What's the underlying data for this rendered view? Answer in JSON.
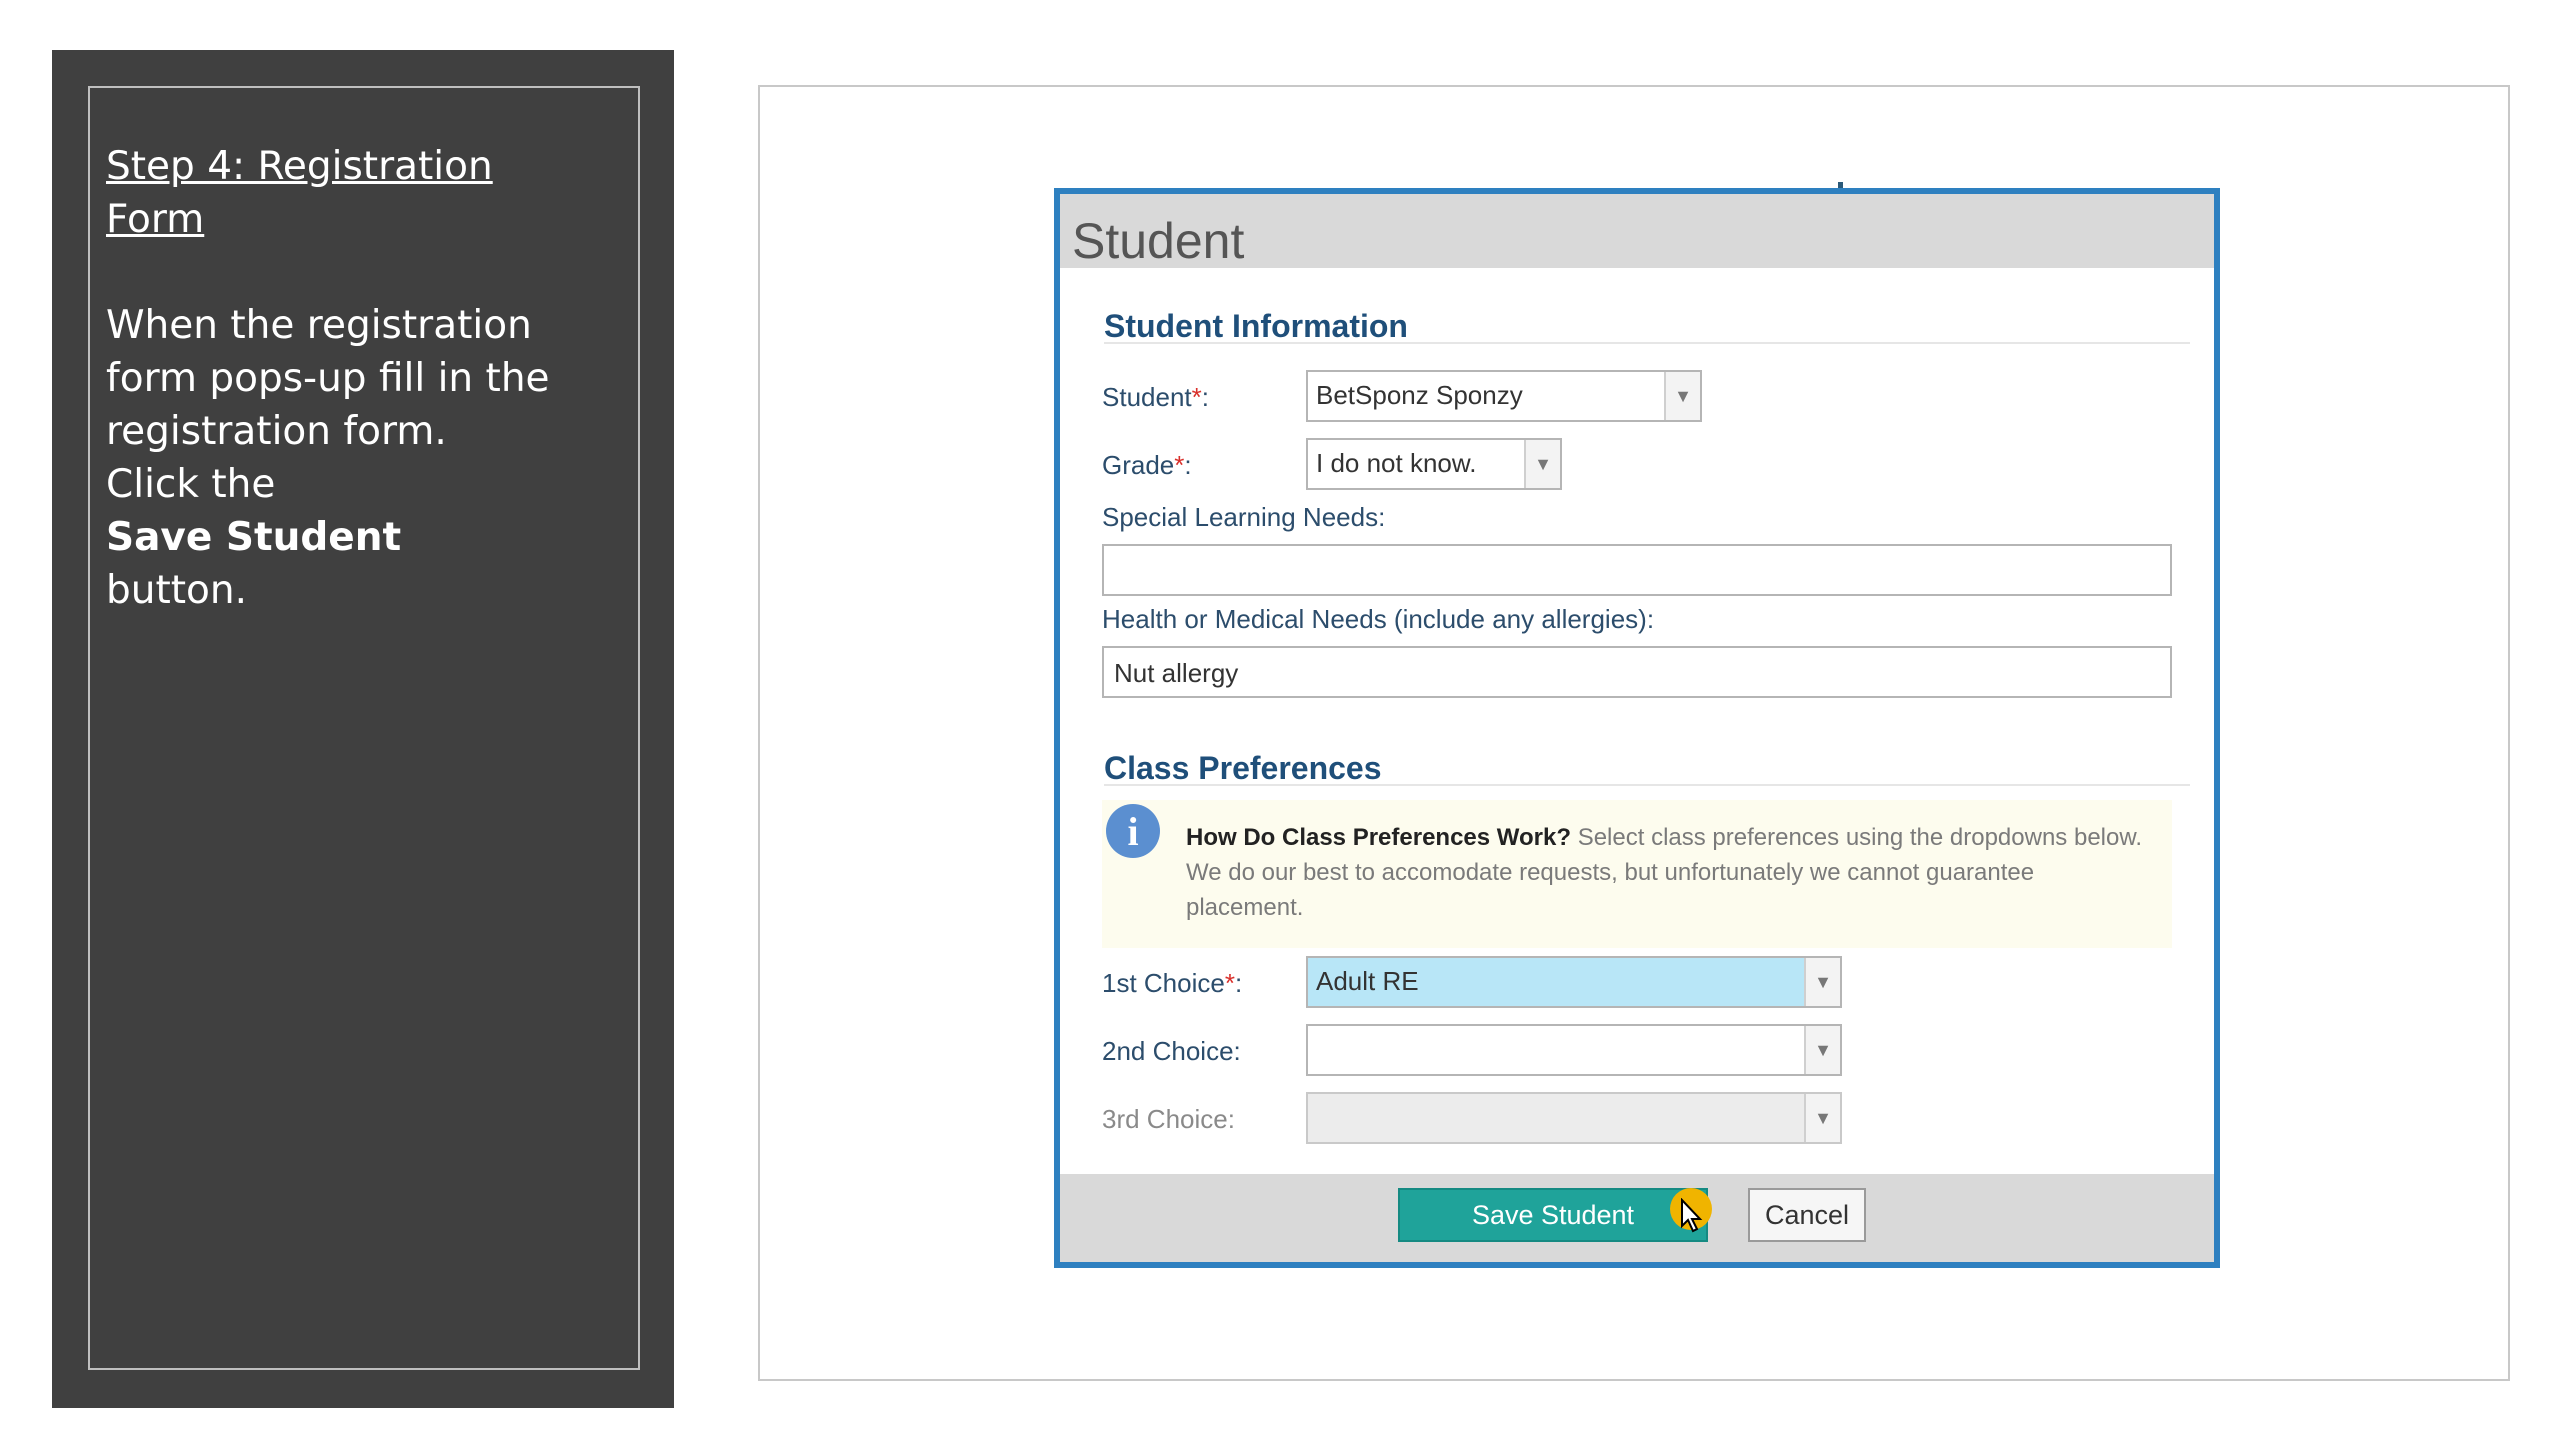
{
  "left_panel": {
    "step_title_line1": "Step 4: Registration",
    "step_title_line2": "Form",
    "text_line1": "When the registration",
    "text_line2": "form pops-up fill in the",
    "text_line3": "registration form.",
    "text_line4": "Click the",
    "text_bold": "Save Student",
    "text_line5": "button."
  },
  "dialog": {
    "title": "Student",
    "student_info": {
      "section_title": "Student Information",
      "student_label": "Student",
      "student_value": "BetSponz Sponzy",
      "grade_label": "Grade",
      "grade_value": "I do not know.",
      "required_mark": "*",
      "label_colon": ":",
      "special_needs_label": "Special Learning Needs:",
      "special_needs_value": "",
      "health_label": "Health or Medical Needs (include any allergies):",
      "health_value": "Nut allergy"
    },
    "class_prefs": {
      "section_title": "Class Preferences",
      "info_title": "How Do Class Preferences Work?",
      "info_text": " Select class preferences using the dropdowns below. We do our best to accomodate requests, but unfortunately we cannot guarantee placement.",
      "first_label": "1st Choice",
      "first_value": "Adult RE",
      "second_label": "2nd Choice:",
      "second_value": "",
      "third_label": "3rd Choice:",
      "third_value": ""
    },
    "footer": {
      "save_label": "Save Student",
      "cancel_label": "Cancel"
    }
  },
  "colors": {
    "dialog_border": "#2e80c0",
    "save_button": "#1fa39a",
    "selected_dropdown": "#b8e6f7",
    "cursor_highlight": "#f0b400"
  },
  "icons": [
    "info-icon",
    "chevron-down-icon",
    "cursor-icon"
  ]
}
